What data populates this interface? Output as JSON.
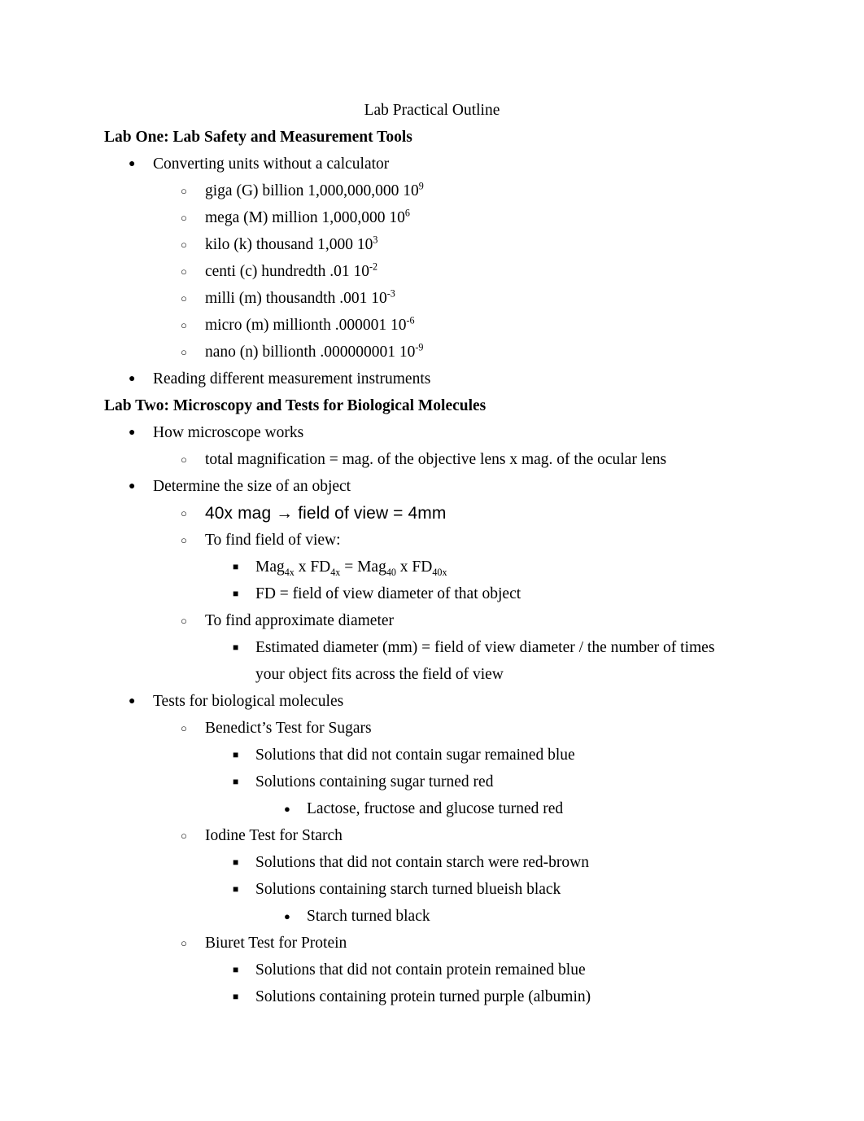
{
  "document": {
    "title": "Lab Practical Outline",
    "bullet_glyphs": {
      "level1": "●",
      "level2": "○",
      "level3": "■",
      "level4": "●"
    },
    "colors": {
      "text": "#000000",
      "background": "#ffffff"
    },
    "sections": [
      {
        "heading": "Lab One: Lab Safety and Measurement Tools",
        "items": [
          {
            "level": 1,
            "text": "Converting units without a calculator"
          },
          {
            "level": 2,
            "text": "giga (G) billion 1,000,000,000 10",
            "superscript": "9"
          },
          {
            "level": 2,
            "text": "mega (M) million 1,000,000 10",
            "superscript": "6"
          },
          {
            "level": 2,
            "text": "kilo (k) thousand 1,000 10",
            "superscript": "3"
          },
          {
            "level": 2,
            "text": "centi (c) hundredth .01 10",
            "superscript": "-2"
          },
          {
            "level": 2,
            "text": "milli (m) thousandth .001 10",
            "superscript": "-3"
          },
          {
            "level": 2,
            "text": "micro (m) millionth .000001 10",
            "superscript": "-6"
          },
          {
            "level": 2,
            "text": "nano (n) billionth .000000001 10",
            "superscript": "-9"
          },
          {
            "level": 1,
            "text": "Reading different measurement instruments"
          }
        ]
      },
      {
        "heading": "Lab Two: Microscopy and Tests for Biological Molecules",
        "items": [
          {
            "level": 1,
            "text": "How microscope works"
          },
          {
            "level": 2,
            "text": "total magnification = mag. of the objective lens x mag. of the ocular lens"
          },
          {
            "level": 1,
            "text": "Determine the size of an object"
          },
          {
            "level": 2,
            "style": "sans",
            "text": "40x mag → field of view = 4mm"
          },
          {
            "level": 2,
            "text": "To find field of view:"
          },
          {
            "level": 3,
            "formula": true,
            "text_parts": [
              {
                "t": "Mag"
              },
              {
                "sub": "4x"
              },
              {
                "t": " x FD"
              },
              {
                "sub": "4x"
              },
              {
                "t": " = Mag"
              },
              {
                "sub": "40"
              },
              {
                "t": " x FD"
              },
              {
                "sub": "40x"
              }
            ],
            "text": "Mag4x x FD4x = Mag40 x FD40x"
          },
          {
            "level": 3,
            "text": "FD = field of view diameter of that object"
          },
          {
            "level": 2,
            "text": "To find approximate diameter"
          },
          {
            "level": 3,
            "wrap": true,
            "text": "Estimated diameter (mm) = field of view diameter / the number of times your object fits across the field of view"
          },
          {
            "level": 1,
            "text": "Tests for biological molecules"
          },
          {
            "level": 2,
            "text": "Benedict’s Test for Sugars"
          },
          {
            "level": 3,
            "text": "Solutions that did not contain sugar remained blue"
          },
          {
            "level": 3,
            "text": "Solutions containing sugar turned red"
          },
          {
            "level": 4,
            "text": "Lactose, fructose and glucose turned red"
          },
          {
            "level": 2,
            "text": "Iodine Test for Starch"
          },
          {
            "level": 3,
            "text": "Solutions that did not contain starch were red-brown"
          },
          {
            "level": 3,
            "text": "Solutions containing starch turned blueish black"
          },
          {
            "level": 4,
            "text": "Starch turned black"
          },
          {
            "level": 2,
            "text": "Biuret Test for Protein"
          },
          {
            "level": 3,
            "text": "Solutions that did not contain protein remained blue"
          },
          {
            "level": 3,
            "text": "Solutions containing protein turned purple (albumin)"
          }
        ]
      }
    ]
  }
}
